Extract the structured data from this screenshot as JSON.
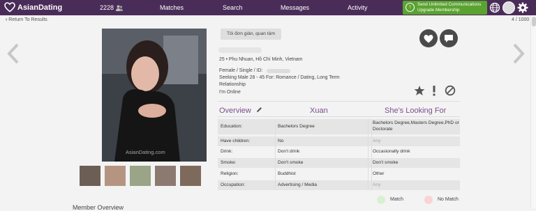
{
  "nav": {
    "brand": "AsianDating",
    "count": "2228",
    "links": [
      "Matches",
      "Search",
      "Messages",
      "Activity"
    ],
    "upgrade_line1": "Send Unlimited Communications",
    "upgrade_line2": "Upgrade Membership"
  },
  "subbar": {
    "back_label": "Return To Results",
    "position": "4 / 1000"
  },
  "profile": {
    "tag": "Tôi đơn giản, quan tâm",
    "location": "25 • Phu Nhuan, Hồ Chí Minh, Vietnam",
    "gender_status": "Female / Single / ID:",
    "seeking": "Seeking Male 28 - 45 For: Romance / Dating, Long Term",
    "seeking_cont": "Relationship",
    "online": "I'm Online",
    "watermark": "AsianDating.com"
  },
  "compare": {
    "overview_label": "Overview",
    "her_name": "Xuan",
    "looking_for": "She's Looking For",
    "rows": [
      {
        "label": "Education:",
        "her": "Bachelors Degree",
        "wants": "Bachelors Degree,Masters Degree,PhD or Doctorate",
        "match": true
      },
      {
        "label": "Have children:",
        "her": "No",
        "wants": "Any",
        "match": false
      },
      {
        "label": "Drink:",
        "her": "Don't drink",
        "wants": "Occasionally drink",
        "match": true
      },
      {
        "label": "Smoke:",
        "her": "Don't smoke",
        "wants": "Don't smoke",
        "match": true
      },
      {
        "label": "Religion:",
        "her": "Buddhist",
        "wants": "Other",
        "match": true
      },
      {
        "label": "Occupation:",
        "her": "Advertising / Media",
        "wants": "Any",
        "match": false
      }
    ]
  },
  "legend": {
    "match_label": "Match",
    "no_match_label": "No Match",
    "match_color": "#d9f0cf",
    "no_match_color": "#fad4d4"
  },
  "colors": {
    "nav_bg": "#4a2c59",
    "accent": "#7a4f8c",
    "upgrade_bg": "#5aa330"
  },
  "bottom_title": "Member Overview"
}
